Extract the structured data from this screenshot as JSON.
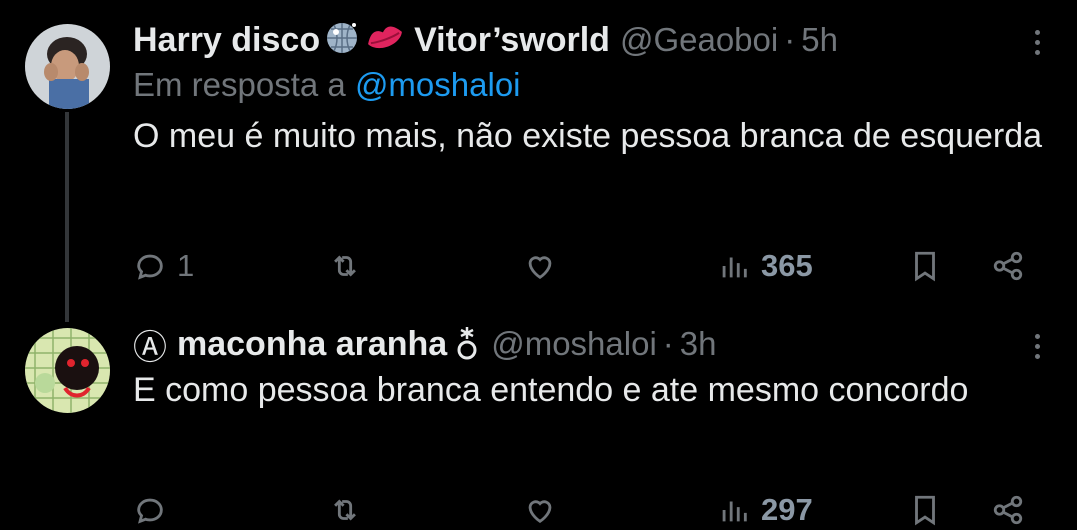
{
  "tweets": [
    {
      "name": "Harry disco",
      "name_suffix": "Vitor’sworld",
      "handle": "@Geaoboi",
      "separator": "·",
      "time": "5h",
      "reply_prefix": "Em resposta a",
      "reply_handle": "@moshaloi",
      "text": "O meu é muito mais, não existe pessoa branca de esquerda",
      "reply_count": "1",
      "retweet_count": "",
      "like_count": "",
      "view_count": "365"
    },
    {
      "name_prefix": "Ⓐ",
      "name": "maconha aranha",
      "handle": "@moshaloi",
      "separator": "·",
      "time": "3h",
      "text": "E como pessoa branca entendo e ate mesmo concordo",
      "reply_count": "",
      "retweet_count": "",
      "like_count": "",
      "view_count": "297"
    }
  ],
  "icons": {
    "more": "more-icon",
    "reply": "reply-icon",
    "retweet": "retweet-icon",
    "like": "heart-icon",
    "views": "views-icon",
    "bookmark": "bookmark-icon",
    "share": "share-icon"
  },
  "colors": {
    "background": "#000000",
    "text": "#e7e9ea",
    "muted": "#71767b",
    "link": "#1d9bf0"
  }
}
